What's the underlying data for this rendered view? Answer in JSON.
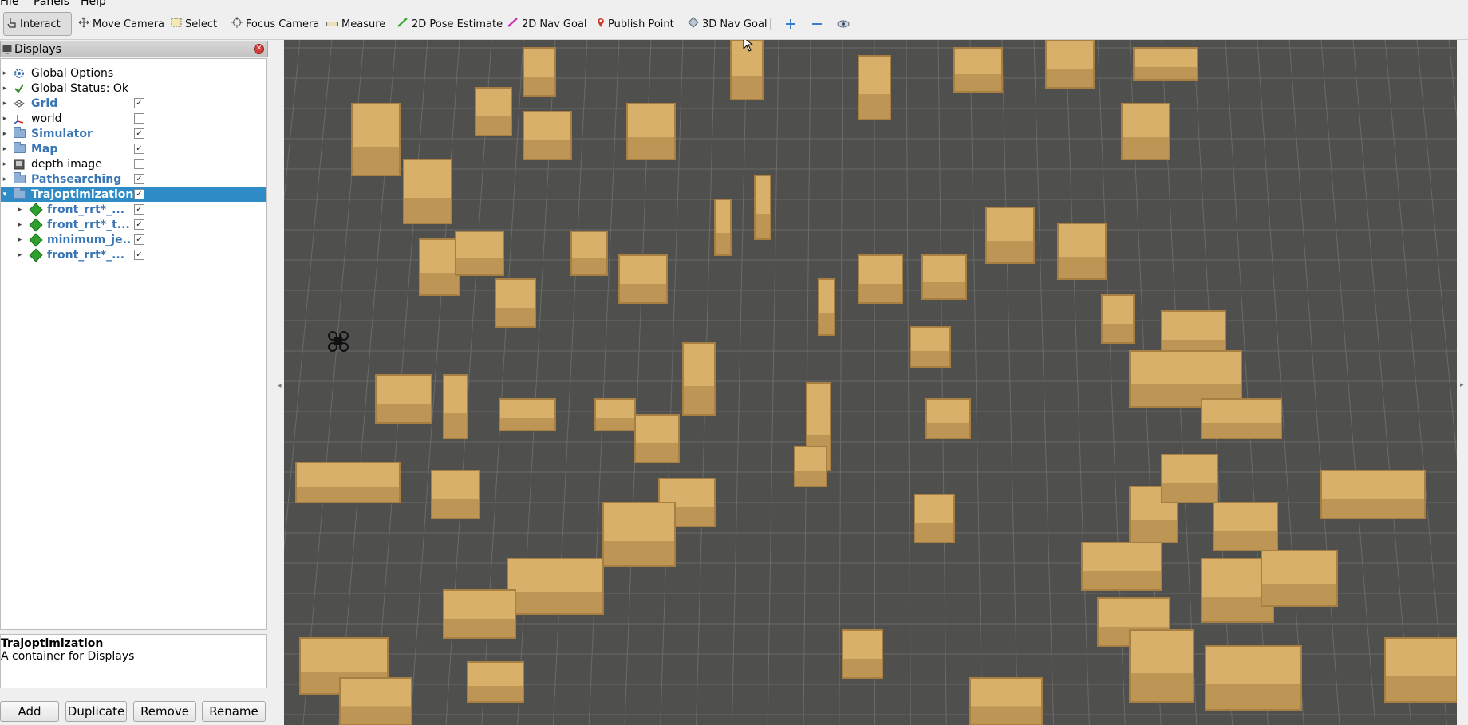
{
  "menubar": {
    "items": [
      "File",
      "Panels",
      "Help"
    ]
  },
  "toolbar": {
    "interact": "Interact",
    "move_camera": "Move Camera",
    "select": "Select",
    "focus_camera": "Focus Camera",
    "measure": "Measure",
    "pose_estimate": "2D Pose Estimate",
    "nav_goal_2d": "2D Nav Goal",
    "publish_point": "Publish Point",
    "nav_goal_3d": "3D Nav Goal"
  },
  "displays": {
    "title": "Displays",
    "items": [
      {
        "label": "Global Options",
        "checked": null
      },
      {
        "label": "Global Status: Ok",
        "checked": null
      },
      {
        "label": "Grid",
        "checked": true
      },
      {
        "label": "world",
        "checked": false
      },
      {
        "label": "Simulator",
        "checked": true
      },
      {
        "label": "Map",
        "checked": true
      },
      {
        "label": "depth image",
        "checked": false
      },
      {
        "label": "Pathsearching",
        "checked": true
      },
      {
        "label": "Trajoptimization",
        "checked": true
      },
      {
        "label": "front_rrt*_...",
        "checked": true
      },
      {
        "label": "front_rrt*_t...",
        "checked": true
      },
      {
        "label": "minimum_je...",
        "checked": true
      },
      {
        "label": "front_rrt*_...",
        "checked": true
      }
    ],
    "check_mark": "✓"
  },
  "description": {
    "title": "Trajoptimization",
    "text": "A container for Displays"
  },
  "buttons": {
    "add": "Add",
    "duplicate": "Duplicate",
    "remove": "Remove",
    "rename": "Rename"
  },
  "colors": {
    "selection": "#308cc6",
    "grid_bg": "#4f4f4d",
    "grid_line": "#6a6a68",
    "voxel": "#d8b06a",
    "voxel_shade": "#a77f42"
  }
}
